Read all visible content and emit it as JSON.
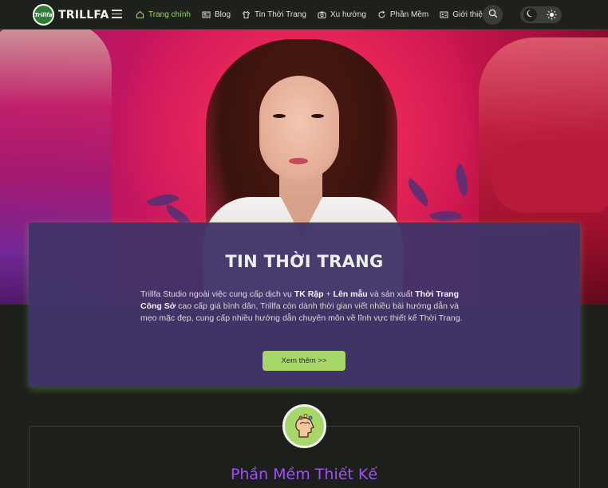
{
  "header": {
    "logo_badge": "Trillfa",
    "logo_text": "TRILLFA",
    "nav": [
      {
        "label": "Trang chính",
        "icon": "home-icon",
        "active": true
      },
      {
        "label": "Blog",
        "icon": "newspaper-icon",
        "active": false
      },
      {
        "label": "Tin Thời Trang",
        "icon": "shirt-icon",
        "active": false
      },
      {
        "label": "Xu hướng",
        "icon": "camera-icon",
        "active": false
      },
      {
        "label": "Phần Mềm",
        "icon": "refresh-icon",
        "active": false
      },
      {
        "label": "Giới thiệu",
        "icon": "profile-card-icon",
        "active": false
      }
    ]
  },
  "card": {
    "title": "TIN THỜI TRANG",
    "text_1": "Trillfa Studio ngoài việc cung cấp dịch vụ ",
    "text_b1": "TK Rập",
    "text_2": " + ",
    "text_b2": "Lên mẫu",
    "text_3": " và sản xuất ",
    "text_b3": "Thời Trang Công Sở",
    "text_4": " cao cấp giá bình dân, Trillfa còn dành thời gian viết nhiều bài hướng dẫn và mẹo mặc đẹp, cung cấp nhiều hướng dẫn chuyên môn về lĩnh vực thiết kế Thời Trang.",
    "button": "Xem thêm >>"
  },
  "section2": {
    "title": "Phần Mềm Thiết Kế",
    "icon": "creative-mind-icon"
  },
  "colors": {
    "accent_green": "#a7d669",
    "nav_active": "#9ad66a",
    "card_bg": "#423468",
    "section_title": "#a24dff"
  }
}
